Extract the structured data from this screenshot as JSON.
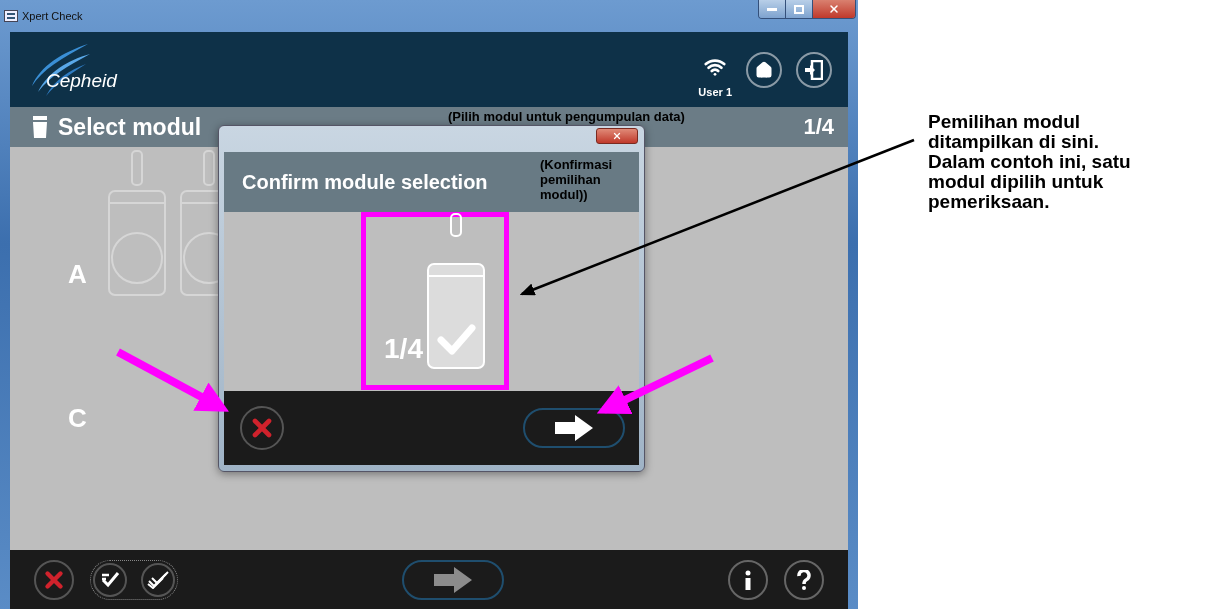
{
  "window": {
    "title": "Xpert Check"
  },
  "header": {
    "logo": "Cepheid",
    "user": "User 1"
  },
  "subheader": {
    "title": "Select modul",
    "page": "1/4"
  },
  "rows": [
    {
      "label": "A",
      "modules": [
        {
          "selected": false
        },
        {
          "selected": false
        }
      ]
    },
    {
      "label": "C",
      "modules": []
    }
  ],
  "dialog": {
    "title": "Confirm module selection",
    "module": {
      "count": "1/4",
      "checked": true
    }
  },
  "annotations": {
    "subheader_translation": "(Pilih modul untuk pengumpulan data)",
    "dialog_translation": "(Konfirmasi pemilihan modul))",
    "note": "Pemilihan modul ditampilkan di sini. Dalam contoh ini, satu modul dipilih untuk pemeriksaan."
  }
}
